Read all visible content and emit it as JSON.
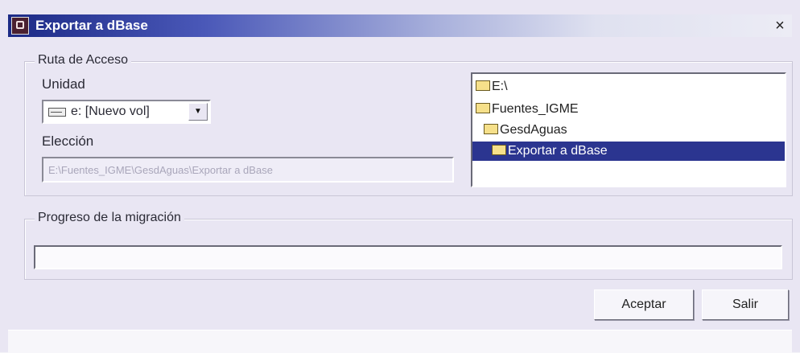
{
  "window": {
    "title": "Exportar a dBase",
    "close_symbol": "×"
  },
  "ruta": {
    "group_label": "Ruta de Acceso",
    "unidad_label": "Unidad",
    "unidad_value": "e: [Nuevo vol]",
    "eleccion_label": "Elección",
    "eleccion_value": "E:\\Fuentes_IGME\\GesdAguas\\Exportar a dBase"
  },
  "tree": {
    "items": [
      {
        "label": "E:\\",
        "icon": "open-folder-icon",
        "selected": false
      },
      {
        "label": "Fuentes_IGME",
        "icon": "open-folder-icon",
        "selected": false
      },
      {
        "label": "GesdAguas",
        "icon": "open-folder-icon",
        "selected": false
      },
      {
        "label": "Exportar a dBase",
        "icon": "open-folder-icon",
        "selected": true
      }
    ]
  },
  "progreso": {
    "group_label": "Progreso de la migración",
    "value": 0
  },
  "buttons": {
    "aceptar": "Aceptar",
    "salir": "Salir"
  },
  "colors": {
    "selection": "#2b3590",
    "title_gradient_start": "#1c2a86"
  }
}
